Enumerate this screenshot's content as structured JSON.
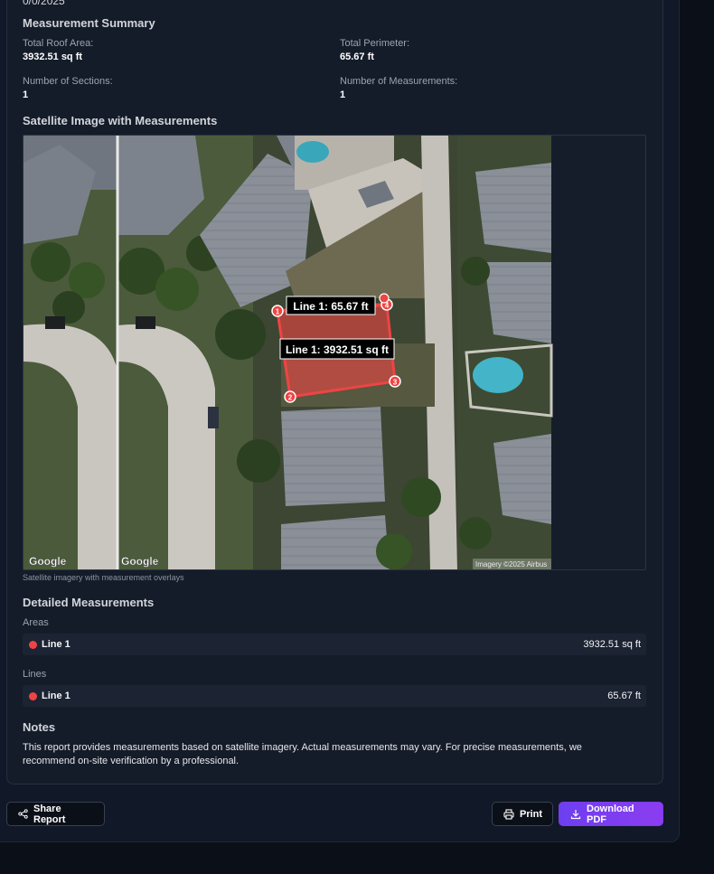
{
  "header": {
    "date_partial": "0/0/2025"
  },
  "summary": {
    "title": "Measurement Summary",
    "total_roof_area_label": "Total Roof Area:",
    "total_roof_area_value": "3932.51 sq ft",
    "total_perimeter_label": "Total Perimeter:",
    "total_perimeter_value": "65.67 ft",
    "sections_label": "Number of Sections:",
    "sections_value": "1",
    "measurements_label": "Number of Measurements:",
    "measurements_value": "1"
  },
  "satellite": {
    "title": "Satellite Image with Measurements",
    "line_label": "Line 1: 65.67 ft",
    "area_label": "Line 1: 3932.51 sq ft",
    "vertex_labels": [
      "1",
      "2",
      "3",
      "4"
    ],
    "google_logo_1": "Google",
    "google_logo_2": "Google",
    "imagery_credit": "Imagery ©2025 Airbus",
    "caption": "Satellite imagery with measurement overlays",
    "overlay_color": "#ef4444"
  },
  "details": {
    "title": "Detailed Measurements",
    "areas_label": "Areas",
    "areas": [
      {
        "name": "Line 1",
        "value": "3932.51 sq ft"
      }
    ],
    "lines_label": "Lines",
    "lines": [
      {
        "name": "Line 1",
        "value": "65.67 ft"
      }
    ]
  },
  "notes": {
    "title": "Notes",
    "text": "This report provides measurements based on satellite imagery. Actual measurements may vary. For precise measurements, we recommend on-site verification by a professional."
  },
  "actions": {
    "share_label": "Share Report",
    "print_label": "Print",
    "download_label": "Download PDF",
    "share_icon": "share-icon",
    "print_icon": "printer-icon",
    "download_icon": "download-icon"
  },
  "colors": {
    "accent": "#7c3aed",
    "overlay": "#ef4444",
    "panel": "#151c29"
  }
}
